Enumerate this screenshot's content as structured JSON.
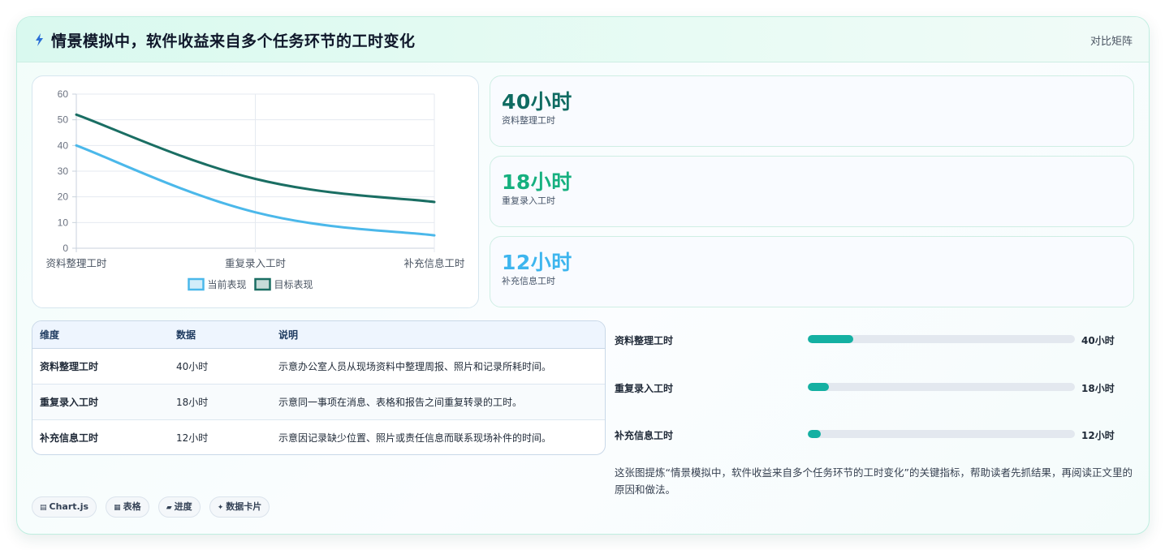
{
  "header": {
    "title": "情景模拟中，软件收益来自多个任务环节的工时变化",
    "tag": "对比矩阵"
  },
  "chart_data": {
    "type": "line",
    "categories": [
      "资料整理工时",
      "重复录入工时",
      "补充信息工时"
    ],
    "series": [
      {
        "name": "当前表现",
        "values": [
          40,
          14,
          5
        ],
        "color": "#4bb8ea"
      },
      {
        "name": "目标表现",
        "values": [
          52,
          27,
          18
        ],
        "color": "#1a6e63"
      }
    ],
    "ylim": [
      0,
      60
    ],
    "yticks": [
      0,
      10,
      20,
      30,
      40,
      50,
      60
    ],
    "grid": true,
    "legend": "bottom-center"
  },
  "kpis": [
    {
      "value": "40小时",
      "label": "资料整理工时",
      "color": "#0f6b61"
    },
    {
      "value": "18小时",
      "label": "重复录入工时",
      "color": "#16b07f"
    },
    {
      "value": "12小时",
      "label": "补充信息工时",
      "color": "#3db5ee"
    }
  ],
  "table": {
    "headers": [
      "维度",
      "数据",
      "说明"
    ],
    "rows": [
      [
        "资料整理工时",
        "40小时",
        "示意办公室人员从现场资料中整理周报、照片和记录所耗时间。"
      ],
      [
        "重复录入工时",
        "18小时",
        "示意同一事项在消息、表格和报告之间重复转录的工时。"
      ],
      [
        "补充信息工时",
        "12小时",
        "示意因记录缺少位置、照片或责任信息而联系现场补件的时间。"
      ]
    ]
  },
  "progress": [
    {
      "label": "资料整理工时",
      "value_text": "40小时",
      "fraction": 0.17
    },
    {
      "label": "重复录入工时",
      "value_text": "18小时",
      "fraction": 0.08
    },
    {
      "label": "补充信息工时",
      "value_text": "12小时",
      "fraction": 0.05
    }
  ],
  "summary": "这张图提炼“情景模拟中，软件收益来自多个任务环节的工时变化”的关键指标，帮助读者先抓结果，再阅读正文里的原因和做法。",
  "chips": [
    {
      "icon": "chart-icon",
      "glyph": "▤",
      "label": "Chart.js"
    },
    {
      "icon": "table-icon",
      "glyph": "▦",
      "label": "表格"
    },
    {
      "icon": "progress-icon",
      "glyph": "▰",
      "label": "进度"
    },
    {
      "icon": "sparkle-icon",
      "glyph": "✦",
      "label": "数据卡片"
    }
  ]
}
